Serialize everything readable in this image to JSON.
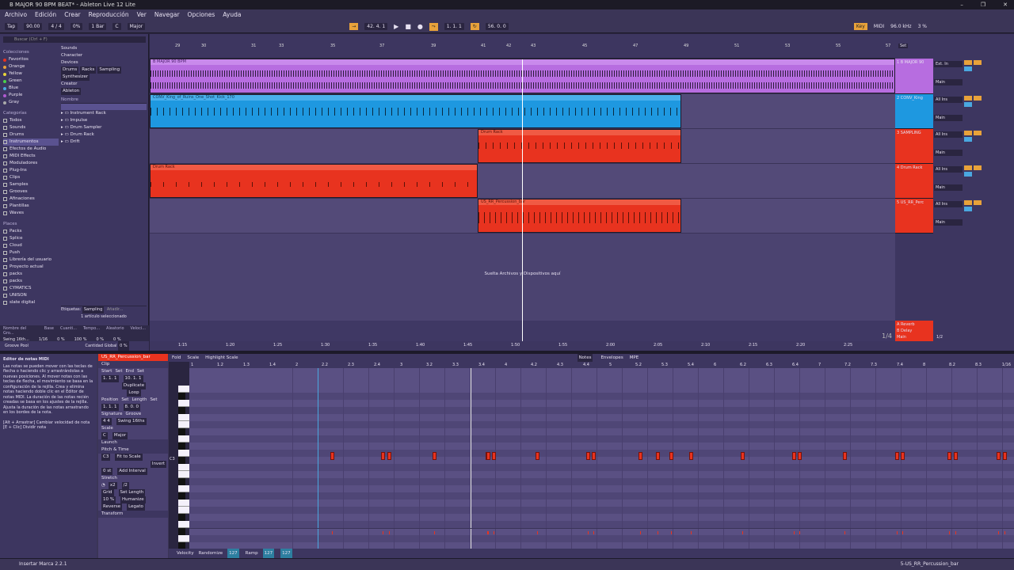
{
  "window": {
    "title": "B MAJOR 90 BPM BEAT* - Ableton Live 12 Lite"
  },
  "menu": [
    "Archivo",
    "Edición",
    "Crear",
    "Reproducción",
    "Ver",
    "Navegar",
    "Opciones",
    "Ayuda"
  ],
  "transport": {
    "tap": "Tap",
    "bpm": "90.00",
    "sig": "4 / 4",
    "swing": "0%",
    "bar": "1 Bar",
    "key": "C",
    "scale": "Major",
    "position": "42. 4. 1",
    "loop_start": "1. 1. 1",
    "loop_len": "56. 0. 0",
    "key_btn": "Key",
    "midi": "MIDI",
    "sample_rate": "96.0 kHz",
    "cpu": "3 %"
  },
  "browser": {
    "search_placeholder": "Buscar (Ctrl + F)",
    "collections_title": "Colecciones",
    "collections": [
      {
        "label": "Favoritos",
        "color": "#e8331f"
      },
      {
        "label": "Orange",
        "color": "#e8a23a"
      },
      {
        "label": "Yellow",
        "color": "#e8d43a"
      },
      {
        "label": "Green",
        "color": "#4ad04a"
      },
      {
        "label": "Blue",
        "color": "#4aa8e0"
      },
      {
        "label": "Purple",
        "color": "#b05ad0"
      },
      {
        "label": "Gray",
        "color": "#aaaaaa"
      }
    ],
    "categories_title": "Categorías",
    "categories": [
      "Todos",
      "Sounds",
      "Drums",
      "Instrumentos",
      "Efectos de Audio",
      "MIDI Effects",
      "Moduladores",
      "Plug-Ins",
      "Clips",
      "Samples",
      "Grooves",
      "Afinaciones",
      "Plantillas",
      "Waves"
    ],
    "places_title": "Places",
    "places": [
      "Packs",
      "Splice",
      "Cloud",
      "Push",
      "Librería del usuario",
      "Proyecto actual",
      "packs",
      "packs",
      "CYMATICS",
      "UNISON",
      "slate digital"
    ],
    "filters": [
      "Sounds",
      "Character",
      "Devices",
      "Creator"
    ],
    "chips": [
      "Drums",
      "Racks",
      "Sampling",
      "Synthesizer"
    ],
    "creator_chip": "Ableton",
    "name_header": "Nombre",
    "items": [
      "Instrument Rack",
      "Impulse",
      "Drum Sampler",
      "Drum Rack",
      "Drift"
    ],
    "tags_label": "Etiquetas:",
    "tag_value": "Sampling",
    "tag_add": "Añadir...",
    "selected_info": "1 artículo seleccionado"
  },
  "groove": {
    "headers": [
      "Nombre del Gro...",
      "Base",
      "Cuanti...",
      "Tempo...",
      "Aleatorio",
      "Veloci..."
    ],
    "row": [
      "Swing 16th...",
      "1/16",
      "0 %",
      "100 %",
      "0 %",
      "0 %"
    ],
    "pool": "Groove Pool",
    "global_label": "Cantidad Global",
    "global_value": "0 %"
  },
  "arrangement": {
    "ruler": [
      "29",
      "30",
      "31",
      "33",
      "35",
      "37",
      "39",
      "41",
      "42",
      "43",
      "45",
      "47",
      "49",
      "51",
      "53",
      "55",
      "57"
    ],
    "drop_text": "Suelta Archivos y Dispositivos aquí",
    "clips": [
      {
        "name": "B MAJOR 90 BPM",
        "color": "#b76de0"
      },
      {
        "name": "CONV_King_of_Ruins_One_Shot_Kick_170",
        "color": "#1e98e0"
      },
      {
        "name": "Drum Rack",
        "color": "#e8331f"
      },
      {
        "name": "Drum Rack",
        "color": "#e8331f"
      },
      {
        "name": "Drum Rack",
        "color": "#e8331f"
      },
      {
        "name": "US_RR_Percussion_bar",
        "color": "#e8331f"
      }
    ],
    "timeline": [
      "1:15",
      "1:20",
      "1:25",
      "1:30",
      "1:35",
      "1:40",
      "1:45",
      "1:50",
      "1:55",
      "2:00",
      "2:05",
      "2:10",
      "2:15",
      "2:20",
      "2:25"
    ],
    "zoom": "1/4"
  },
  "tracks": [
    {
      "name": "1 B MAJOR 90",
      "color": "#b76de0",
      "input": "Ext. In",
      "out": "Main"
    },
    {
      "name": "2 CONV_King",
      "color": "#1e98e0",
      "input": "All Ins",
      "out": "Main"
    },
    {
      "name": "3 SAMPLING",
      "color": "#e8331f",
      "input": "All Ins",
      "out": "Main"
    },
    {
      "name": "4 Drum Rack",
      "color": "#e8331f",
      "input": "All Ins",
      "out": "Main"
    },
    {
      "name": "5 US_RR_Perc",
      "color": "#e8331f",
      "input": "All Ins",
      "out": "Main"
    }
  ],
  "returns": [
    "A Reverb",
    "B Delay",
    "Main"
  ],
  "master": {
    "label": "Main",
    "value": "1/2"
  },
  "set_btn": "Set",
  "clip": {
    "tabs": [
      "Fold",
      "Scale",
      "Highlight Scale"
    ],
    "right_tabs": [
      "Notes",
      "Envelopes",
      "MPE"
    ],
    "name": "US_RR_Percussion_bar",
    "section_clip": "Clip",
    "start_label": "Start",
    "end_label": "End",
    "set_label": "Set",
    "start": "1. 1. 1",
    "end": "10. 1. 1",
    "duplicate": "Duplicate",
    "loop": "Loop",
    "position_label": "Position",
    "length_label": "Length",
    "position": "1. 1. 1",
    "length": "8. 0. 0",
    "signature_label": "Signature",
    "groove_label": "Groove",
    "sig": "4  4",
    "groove": "Swing 16ths",
    "scale_label": "Scale",
    "scale_key": "C",
    "scale_name": "Major",
    "launch": "Launch",
    "pitch": "Pitch & Time",
    "pitch_note": "C3",
    "fit": "Fit to Scale",
    "invert": "Invert",
    "transpose": "0 st",
    "add_interval": "Add Interval",
    "stretch": "Stretch",
    "x2": "x2",
    "div2": "/2",
    "grid": "Grid",
    "set_length": "Set Length",
    "humanize_val": "10 %",
    "humanize": "Humanize",
    "reverse": "Reverse",
    "legato": "Legato",
    "transform": "Transform",
    "bar_ruler": [
      "1",
      "1.2",
      "1.3",
      "1.4",
      "2",
      "2.2",
      "2.3",
      "2.4",
      "3",
      "3.2",
      "3.3",
      "3.4",
      "4",
      "4.2",
      "4.3",
      "4.4",
      "5",
      "5.2",
      "5.3",
      "5.4",
      "6",
      "6.2",
      "6.3",
      "6.4",
      "7",
      "7.2",
      "7.3",
      "7.4",
      "8",
      "8.2",
      "8.3"
    ],
    "grid_q": "1/16",
    "c3": "C3",
    "velocity_label": "Velocity",
    "randomize": "Randomize",
    "rand_val": "127",
    "ramp": "Ramp",
    "ramp_a": "127",
    "ramp_b": "127",
    "vel_scale": [
      "127",
      "64",
      "1"
    ]
  },
  "help": {
    "title": "Editor de notas MIDI",
    "body": "Las notas se pueden mover con las teclas de flecha o haciendo clic y arrastrándolas a nuevas posiciones. Al mover notas con las teclas de flecha, el movimiento se basa en la configuración de la rejilla. Crea y elimina notas haciendo doble clic en el Editor de notas MIDI. La duración de las notas recién creadas se basa en los ajustes de la rejilla. Ajusta la duración de las notas arrastrando en los bordes de la nota.",
    "hint": "[Alt + Arrastrar] Cambiar velocidad de nota   [E + Clic] Dividir nota"
  },
  "status": {
    "left": "Insertar Marca 2.2.1",
    "right": "5-US_RR_Percussion_bar"
  }
}
